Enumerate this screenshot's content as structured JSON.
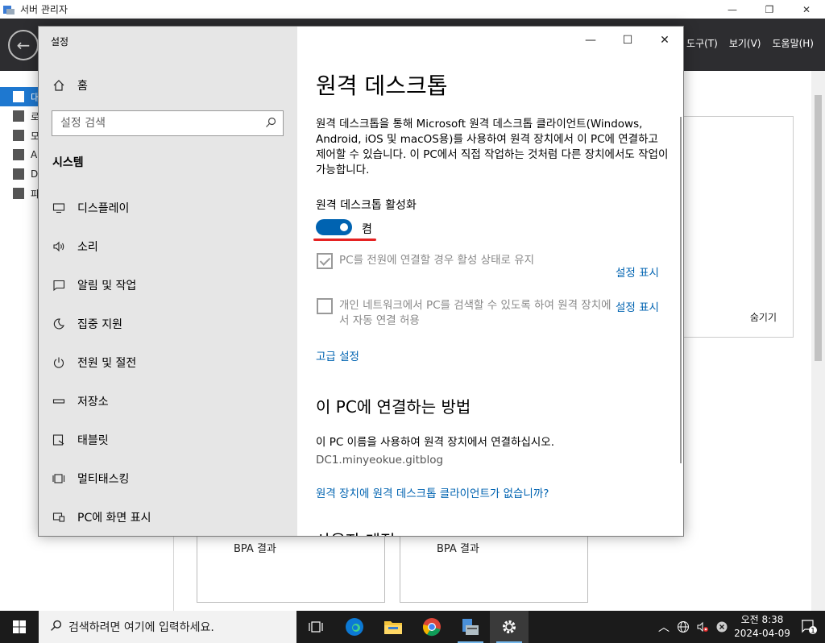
{
  "server_manager": {
    "title": "서버 관리자",
    "menu": [
      "도구(T)",
      "보기(V)",
      "도움말(H)"
    ],
    "nav_items": [
      "대",
      "로",
      "모",
      "A",
      "D",
      "파"
    ],
    "hide_label": "숨기기",
    "bpa_labels": [
      "BPA 결과",
      "BPA 결과"
    ]
  },
  "settings": {
    "window_title": "설정",
    "home_label": "홈",
    "search_placeholder": "설정 검색",
    "section_heading": "시스템",
    "nav": [
      {
        "label": "디스플레이",
        "icon": "monitor-icon"
      },
      {
        "label": "소리",
        "icon": "speaker-icon"
      },
      {
        "label": "알림 및 작업",
        "icon": "notification-icon"
      },
      {
        "label": "집중 지원",
        "icon": "moon-icon"
      },
      {
        "label": "전원 및 절전",
        "icon": "power-icon"
      },
      {
        "label": "저장소",
        "icon": "storage-icon"
      },
      {
        "label": "태블릿",
        "icon": "tablet-icon"
      },
      {
        "label": "멀티태스킹",
        "icon": "multitask-icon"
      },
      {
        "label": "PC에 화면 표시",
        "icon": "project-icon"
      }
    ],
    "page": {
      "title": "원격 데스크톱",
      "description": "원격 데스크톱을 통해 Microsoft 원격 데스크톱 클라이언트(Windows, Android, iOS 및 macOS용)를 사용하여 원격 장치에서 이 PC에 연결하고 제어할 수 있습니다. 이 PC에서 직접 작업하는 것처럼 다른 장치에서도 작업이 가능합니다.",
      "enable_label": "원격 데스크톱 활성화",
      "toggle_state": "켬",
      "toggle_on": true,
      "checkbox1_label": "PC를 전원에 연결할 경우 활성 상태로 유지",
      "checkbox1_checked": true,
      "checkbox2_label": "개인 네트워크에서 PC를 검색할 수 있도록 하여 원격 장치에서 자동 연결 허용",
      "checkbox2_checked": false,
      "show_settings_1": "설정 표시",
      "show_settings_2": "설정 표시",
      "advanced_link": "고급 설정",
      "how_heading": "이 PC에 연결하는 방법",
      "how_desc": "이 PC 이름을 사용하여 원격 장치에서 연결하십시오.",
      "pc_name": "DC1.minyeokue.gitblog",
      "no_client_link": "원격 장치에 원격 데스크톱 클라이언트가 없습니까?",
      "next_heading": "사용자 계정"
    }
  },
  "taskbar": {
    "search_placeholder": "검색하려면 여기에 입력하세요.",
    "time": "오전 8:38",
    "date": "2024-04-09",
    "notification_count": "1"
  },
  "colors": {
    "accent": "#0063b1",
    "underline": "#e52222",
    "sidebar_bg": "#e6e6e6",
    "taskbar_bg": "#1b1b1b"
  }
}
